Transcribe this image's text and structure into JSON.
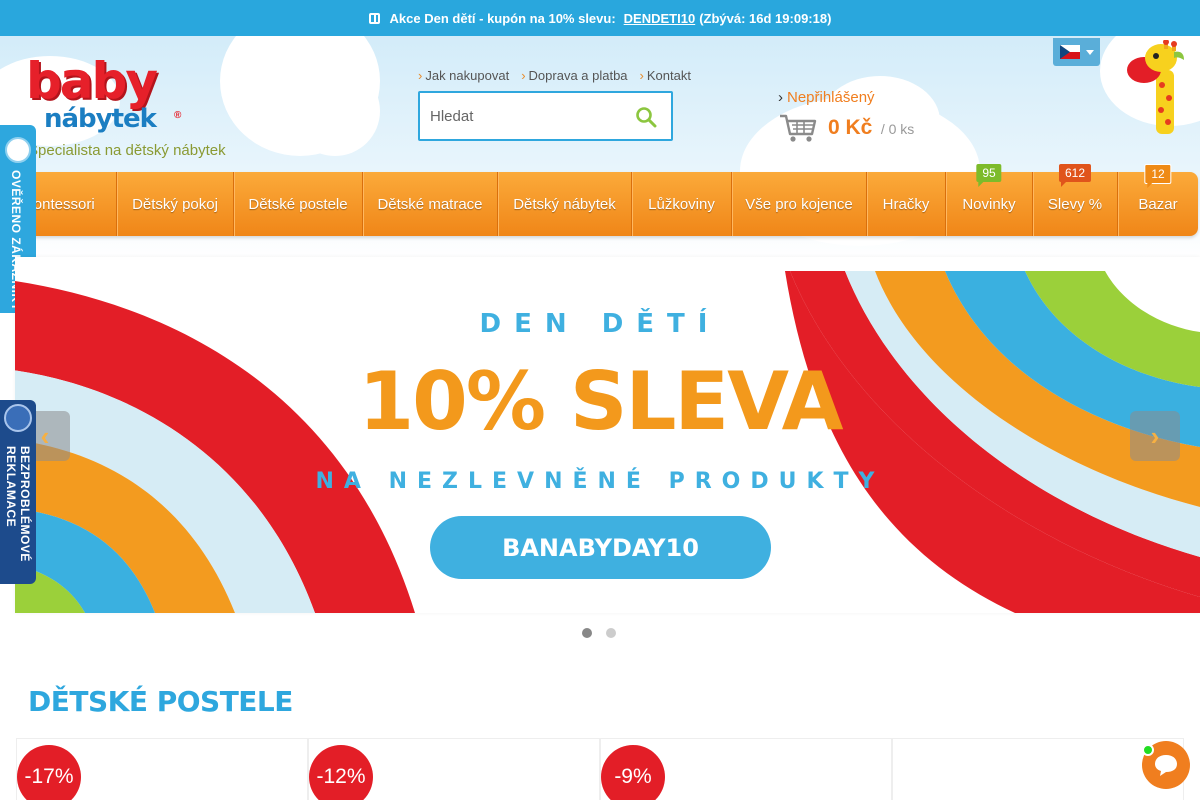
{
  "promo": {
    "text": "Akce Den dětí - kupón na 10% slevu:",
    "code": "DENDETI10",
    "remaining": "(Zbývá: 16d 19:09:18)"
  },
  "logo": {
    "baby": "baby",
    "nabytek": "nábytek",
    "registered": "®"
  },
  "tagline": "Specialista na dětský nábytek",
  "toplinks": [
    {
      "label": "Jak nakupovat"
    },
    {
      "label": "Doprava a platba"
    },
    {
      "label": "Kontakt"
    }
  ],
  "search": {
    "placeholder": "Hledat"
  },
  "account": {
    "label": "Nepřihlášený"
  },
  "cart": {
    "price": "0 Kč",
    "count": "/ 0 ks"
  },
  "nav": [
    {
      "label": "Montessori"
    },
    {
      "label": "Dětský pokoj"
    },
    {
      "label": "Dětské postele"
    },
    {
      "label": "Dětské matrace"
    },
    {
      "label": "Dětský nábytek"
    },
    {
      "label": "Lůžkoviny"
    },
    {
      "label": "Vše pro kojence"
    },
    {
      "label": "Hračky"
    },
    {
      "label": "Novinky",
      "badge": "95"
    },
    {
      "label": "Slevy %",
      "badge": "612"
    },
    {
      "label": "Bazar",
      "badge": "12"
    }
  ],
  "side": {
    "verified": "OVĚŘENO ZÁKAZNÍKY",
    "claims_line1": "BEZPROBLÉMOVÉ",
    "claims_line2": "REKLAMACE"
  },
  "banner": {
    "line1": "DEN DĚTÍ",
    "headline": "10% SLEVA",
    "line2": "NA NEZLEVNĚNÉ PRODUKTY",
    "button": "BANABYDAY10",
    "prev": "‹",
    "next": "›"
  },
  "section": {
    "title": "DĚTSKÉ POSTELE"
  },
  "products": [
    {
      "discount": "-17%"
    },
    {
      "discount": "-12%"
    },
    {
      "discount": "-9%"
    },
    {
      "discount": ""
    }
  ],
  "colors": {
    "brand_blue": "#2ea7de",
    "brand_orange": "#f08618",
    "discount_red": "#e31e27",
    "banner_orange": "#f3991c"
  },
  "icons": [
    "gift-icon",
    "search-icon",
    "cart-icon",
    "czech-flag-icon",
    "giraffe-mascot-icon",
    "chat-icon"
  ]
}
